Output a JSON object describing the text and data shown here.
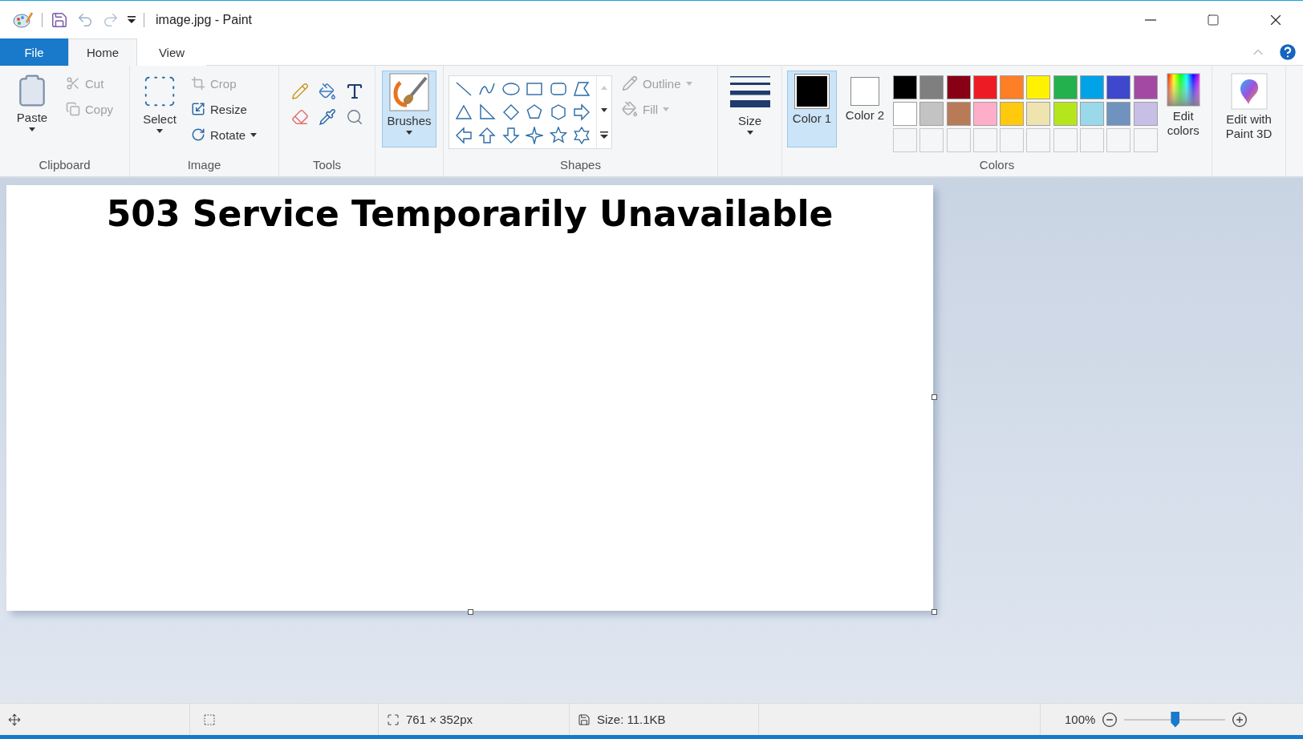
{
  "title_bar": {
    "title": "image.jpg - Paint"
  },
  "tabs": [
    {
      "label": "File",
      "kind": "file",
      "selected": false
    },
    {
      "label": "Home",
      "kind": "tab",
      "selected": true
    },
    {
      "label": "View",
      "kind": "tab",
      "selected": false
    }
  ],
  "ribbon": {
    "clipboard": {
      "label": "Clipboard",
      "paste": "Paste",
      "cut": {
        "label": "Cut",
        "disabled": true
      },
      "copy": {
        "label": "Copy",
        "disabled": true
      }
    },
    "image": {
      "label": "Image",
      "select": "Select",
      "crop": {
        "label": "Crop",
        "disabled": true
      },
      "resize": {
        "label": "Resize",
        "disabled": false
      },
      "rotate": {
        "label": "Rotate",
        "disabled": false
      }
    },
    "tools": {
      "label": "Tools"
    },
    "brushes": {
      "label": "Brushes",
      "selected": true
    },
    "shapes": {
      "label": "Shapes",
      "outline": {
        "label": "Outline",
        "disabled": true
      },
      "fill": {
        "label": "Fill",
        "disabled": true
      }
    },
    "size": {
      "label": "Size"
    },
    "colors": {
      "label": "Colors",
      "color1": {
        "label": "Color 1",
        "color": "#000000",
        "selected": true
      },
      "color2": {
        "label": "Color 2",
        "color": "#ffffff",
        "selected": false
      },
      "palette": [
        {
          "kind": "swatch",
          "color": "#000000"
        },
        {
          "kind": "swatch",
          "color": "#7f7f7f"
        },
        {
          "kind": "swatch",
          "color": "#880015"
        },
        {
          "kind": "swatch",
          "color": "#ed1c24"
        },
        {
          "kind": "swatch",
          "color": "#ff7f27"
        },
        {
          "kind": "swatch",
          "color": "#fff200"
        },
        {
          "kind": "swatch",
          "color": "#22b14c"
        },
        {
          "kind": "swatch",
          "color": "#00a2e8"
        },
        {
          "kind": "swatch",
          "color": "#3f48cc"
        },
        {
          "kind": "swatch",
          "color": "#a349a4"
        },
        {
          "kind": "swatch",
          "color": "#ffffff"
        },
        {
          "kind": "swatch",
          "color": "#c3c3c3"
        },
        {
          "kind": "swatch",
          "color": "#b97a57"
        },
        {
          "kind": "swatch",
          "color": "#ffaec9"
        },
        {
          "kind": "swatch",
          "color": "#ffc90e"
        },
        {
          "kind": "swatch",
          "color": "#efe4b0"
        },
        {
          "kind": "swatch",
          "color": "#b5e61d"
        },
        {
          "kind": "swatch",
          "color": "#99d9ea"
        },
        {
          "kind": "swatch",
          "color": "#7092be"
        },
        {
          "kind": "swatch",
          "color": "#c8bfe7"
        },
        {
          "kind": "empty"
        },
        {
          "kind": "empty"
        },
        {
          "kind": "empty"
        },
        {
          "kind": "empty"
        },
        {
          "kind": "empty"
        },
        {
          "kind": "empty"
        },
        {
          "kind": "empty"
        },
        {
          "kind": "empty"
        },
        {
          "kind": "empty"
        },
        {
          "kind": "empty"
        }
      ],
      "edit_colors": "Edit colors"
    },
    "paint3d": {
      "label": "Edit with Paint 3D"
    }
  },
  "canvas": {
    "text": "503 Service Temporarily Unavailable"
  },
  "status_bar": {
    "dimensions": "761 × 352px",
    "file_size": "Size: 11.1KB",
    "zoom": "100%",
    "zoom_slider": {
      "level": 0.5
    }
  }
}
